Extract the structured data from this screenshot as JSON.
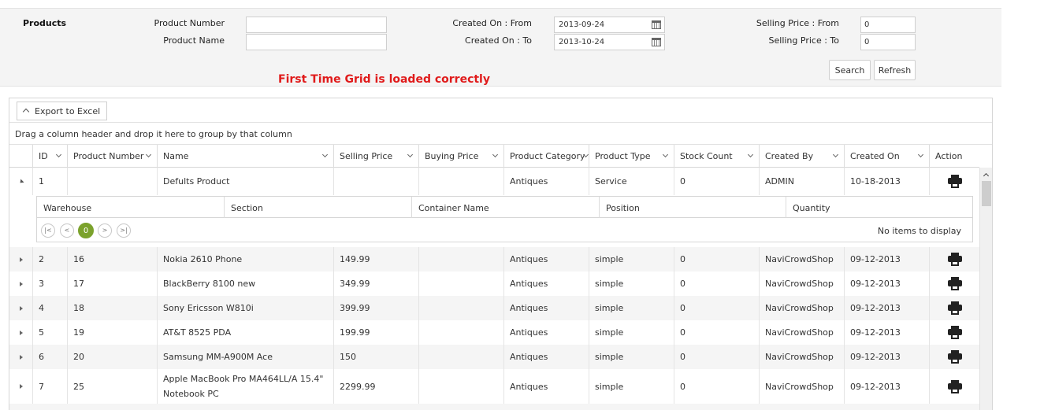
{
  "filters": {
    "panel_title": "Products",
    "product_number_label": "Product Number",
    "product_name_label": "Product Name",
    "product_number_value": "",
    "product_name_value": "",
    "created_from_label": "Created On : From",
    "created_to_label": "Created On : To",
    "created_from_value": "2013-09-24",
    "created_to_value": "2013-10-24",
    "price_from_label": "Selling Price : From",
    "price_to_label": "Selling Price : To",
    "price_from_value": "0",
    "price_to_value": "0",
    "search_label": "Search",
    "refresh_label": "Refresh"
  },
  "notice": "First Time Grid is loaded correctly",
  "grid": {
    "export_label": "Export to Excel",
    "group_hint": "Drag a column header and drop it here to group by that column",
    "columns": [
      "ID",
      "Product Number",
      "Name",
      "Selling Price",
      "Buying Price",
      "Product Category",
      "Product Type",
      "Stock Count",
      "Created By",
      "Created On",
      "Action"
    ],
    "rows": [
      {
        "id": "1",
        "number": "",
        "name": "Defults Product",
        "selling": "",
        "buying": "",
        "category": "Antiques",
        "type": "Service",
        "stock": "0",
        "created_by": "ADMIN",
        "created_on": "10-18-2013"
      },
      {
        "id": "2",
        "number": "16",
        "name": "Nokia 2610 Phone",
        "selling": "149.99",
        "buying": "",
        "category": "Antiques",
        "type": "simple",
        "stock": "0",
        "created_by": "NaviCrowdShop",
        "created_on": "09-12-2013"
      },
      {
        "id": "3",
        "number": "17",
        "name": "BlackBerry 8100 new",
        "selling": "349.99",
        "buying": "",
        "category": "Antiques",
        "type": "simple",
        "stock": "0",
        "created_by": "NaviCrowdShop",
        "created_on": "09-12-2013"
      },
      {
        "id": "4",
        "number": "18",
        "name": "Sony Ericsson W810i",
        "selling": "399.99",
        "buying": "",
        "category": "Antiques",
        "type": "simple",
        "stock": "0",
        "created_by": "NaviCrowdShop",
        "created_on": "09-12-2013"
      },
      {
        "id": "5",
        "number": "19",
        "name": "AT&T 8525 PDA",
        "selling": "199.99",
        "buying": "",
        "category": "Antiques",
        "type": "simple",
        "stock": "0",
        "created_by": "NaviCrowdShop",
        "created_on": "09-12-2013"
      },
      {
        "id": "6",
        "number": "20",
        "name": "Samsung MM-A900M Ace",
        "selling": "150",
        "buying": "",
        "category": "Antiques",
        "type": "simple",
        "stock": "0",
        "created_by": "NaviCrowdShop",
        "created_on": "09-12-2013"
      },
      {
        "id": "7",
        "number": "25",
        "name": "Apple MacBook Pro MA464LL/A 15.4\" Notebook PC",
        "selling": "2299.99",
        "buying": "",
        "category": "Antiques",
        "type": "simple",
        "stock": "0",
        "created_by": "NaviCrowdShop",
        "created_on": "09-12-2013"
      }
    ],
    "detail": {
      "columns": [
        "Warehouse",
        "Section",
        "Container Name",
        "Position",
        "Quantity"
      ],
      "current_page": "0",
      "empty_message": "No items to display"
    }
  }
}
